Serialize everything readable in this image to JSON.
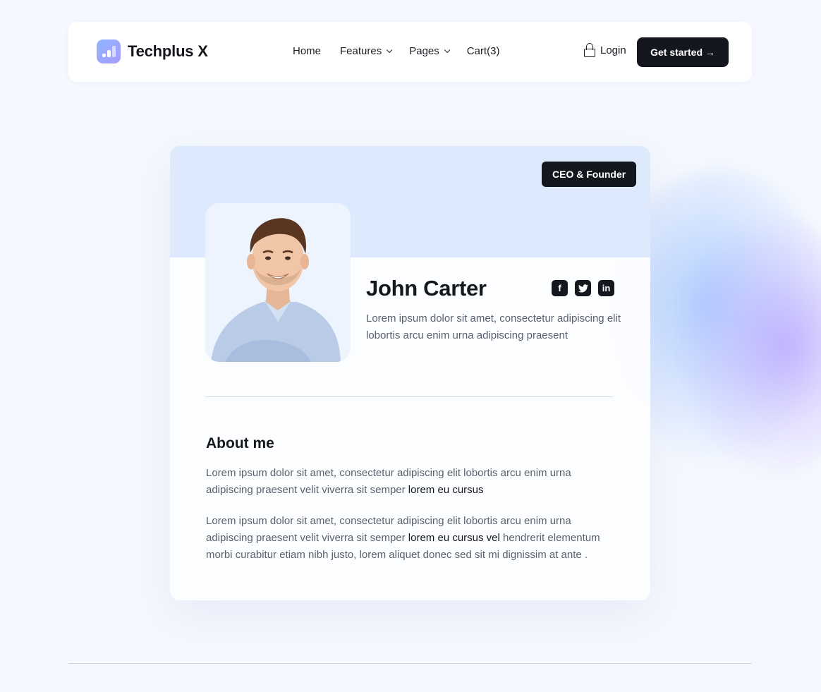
{
  "brand": {
    "name": "Techplus X"
  },
  "nav": {
    "links": [
      {
        "label": "Home"
      },
      {
        "label": "Features"
      },
      {
        "label": "Pages"
      },
      {
        "label": "Cart(3)"
      }
    ],
    "login_label": "Login",
    "cta_label": "Get started →"
  },
  "profile": {
    "role": "CEO & Founder",
    "name": "John Carter",
    "bio": "Lorem ipsum dolor sit amet, consectetur adipiscing elit lobortis arcu enim urna adipiscing praesent",
    "socials": [
      {
        "icon": "facebook-icon",
        "glyph": "f"
      },
      {
        "icon": "twitter-icon",
        "glyph": "🐦"
      },
      {
        "icon": "linkedin-icon",
        "glyph": "in"
      }
    ]
  },
  "about": {
    "title": "About me",
    "p1_text": "Lorem ipsum dolor sit amet, consectetur adipiscing elit lobortis arcu enim urna adipiscing praesent velit viverra sit semper ",
    "p1_link": "lorem eu cursus",
    "p2_text_a": "Lorem ipsum dolor sit amet, consectetur adipiscing elit lobortis arcu enim urna adipiscing praesent velit viverra sit semper ",
    "p2_link": "lorem eu cursus vel",
    "p2_text_b": " hendrerit elementum morbi curabitur etiam nibh justo, lorem aliquet donec sed sit mi dignissim at ante ."
  },
  "colors": {
    "dark": "#15171e",
    "card_header": "#dde9fd",
    "page_bg": "#f5f8fe"
  }
}
